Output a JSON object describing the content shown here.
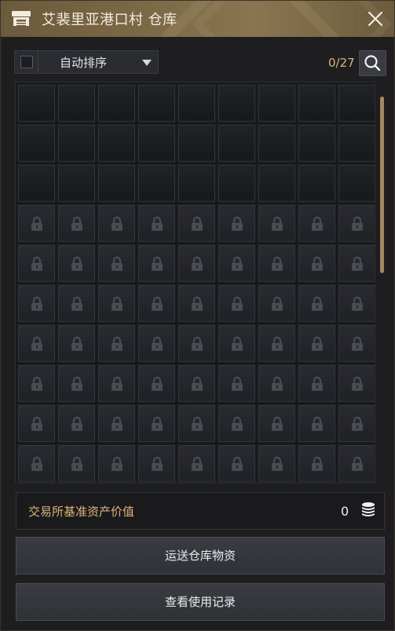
{
  "window": {
    "title": "艾裴里亚港口村 仓库"
  },
  "toolbar": {
    "sort_label": "自动排序",
    "count": "0/27"
  },
  "grid": {
    "columns": 9,
    "unlocked_rows": 3,
    "locked_rows": 7,
    "unlocked_slots": 27,
    "items": []
  },
  "asset": {
    "label": "交易所基准资产价值",
    "value": "0"
  },
  "buttons": {
    "transport": "运送仓库物资",
    "history": "查看使用记录"
  },
  "colors": {
    "accent_gold": "#d9b576",
    "titlebar": "#7b6845",
    "panel_bg": "#1e1e21"
  },
  "icons": {
    "title": "warehouse-icon",
    "close": "close-icon",
    "search": "search-icon",
    "lock": "lock-icon",
    "coin": "coin-stack-icon",
    "dropdown": "chevron-down-icon"
  }
}
